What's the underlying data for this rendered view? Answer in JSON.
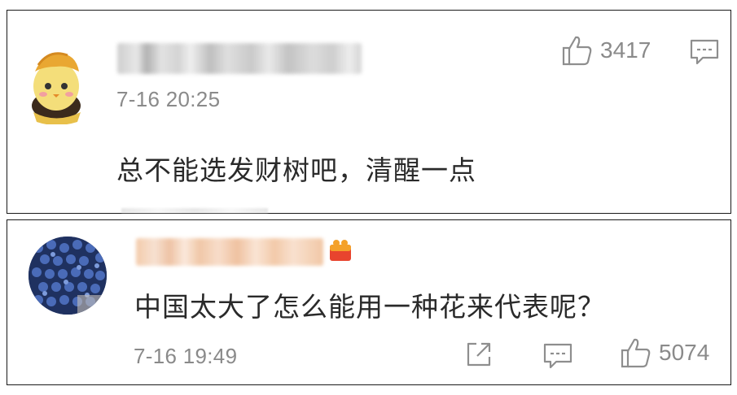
{
  "comments": [
    {
      "username": "",
      "timestamp": "7-16 20:25",
      "text": "总不能选发财树吧，清醒一点",
      "likes": "3417",
      "avatar": "cartoon-chick-avatar",
      "actions": [
        "like-icon",
        "reply-icon"
      ]
    },
    {
      "username": "",
      "timestamp": "7-16 19:49",
      "text": "中国太大了怎么能用一种花来代表呢？",
      "likes": "5074",
      "avatar": "blue-photo-avatar",
      "actions": [
        "share-icon",
        "reply-icon",
        "like-icon"
      ]
    }
  ],
  "colors": {
    "text": "#2a2a2a",
    "meta": "#8a8a8a",
    "border": "#1a1a1a",
    "vip_badge": "#e8442e"
  }
}
